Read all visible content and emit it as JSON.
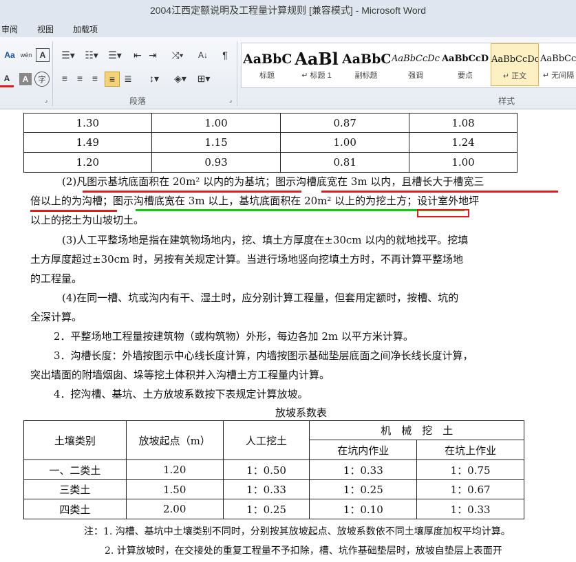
{
  "window": {
    "title": "2004江西定额说明及工程量计算规则 [兼容模式] - Microsoft Word"
  },
  "menu": [
    "审阅",
    "视图",
    "加载项"
  ],
  "ribbon": {
    "paragraph_group": "段落",
    "styles_group": "样式",
    "styles": [
      {
        "sample": "AaBbC",
        "name": "标题"
      },
      {
        "sample": "AaBl",
        "name": "↵ 标题 1"
      },
      {
        "sample": "AaBbC",
        "name": "副标题"
      },
      {
        "sample": "AaBbCcDc",
        "name": "强调"
      },
      {
        "sample": "AaBbCcD",
        "name": "要点"
      },
      {
        "sample": "AaBbCcDc",
        "name": "↵ 正文",
        "active": true
      },
      {
        "sample": "AaBbCcI",
        "name": "↵ 无间隔"
      }
    ]
  },
  "top_table": [
    [
      "1.30",
      "1.00",
      "0.87",
      "1.08"
    ],
    [
      "1.49",
      "1.15",
      "1.00",
      "1.24"
    ],
    [
      "1.20",
      "0.93",
      "0.81",
      "1.00"
    ]
  ],
  "p2": {
    "l1": "(2)凡图示基坑底面积在 20m² 以内的为基坑；图示沟槽底宽在 3m 以内，且槽长大于槽宽三",
    "l2": "倍以上的为沟槽；图示沟槽底宽在 3m 以上，基坑底面积在 20m² 以上的为挖土方；设计室外地坪",
    "l3": "以上的挖土为山坡切土。"
  },
  "p3": {
    "l1": "(3)人工平整场地是指在建筑物场地内，挖、填土方厚度在±30cm 以内的就地找平。挖填",
    "l2": "土方厚度超过±30cm 时，另按有关规定计算。当进行场地竖向挖填土方时，不再计算平整场地",
    "l3": "的工程量。"
  },
  "p4": {
    "l1": "(4)在同一槽、坑或沟内有干、湿土时，应分别计算工程量，但套用定额时，按槽、坑的",
    "l2": "全深计算。"
  },
  "item2": "2．平整场地工程量按建筑物（或构筑物）外形，每边各加 2m 以平方米计算。",
  "item3": {
    "l1": "3．沟槽长度：外墙按图示中心线长度计算，内墙按图示基础垫层底面之间净长线长度计算，",
    "l2": "突出墙面的附墙烟囱、垛等挖土体积并入沟槽土方工程量内计算。"
  },
  "item4": "4．挖沟槽、基坑、土方放坡系数按下表规定计算放坡。",
  "slope_table": {
    "caption": "放坡系数表",
    "headers": {
      "soil": "土壤类别",
      "start": "放坡起点（m）",
      "manual": "人工挖土",
      "machine": "机　械　挖　土",
      "in_pit": "在坑内作业",
      "on_pit": "在坑上作业"
    },
    "rows": [
      [
        "一、二类土",
        "1.20",
        "1：0.50",
        "1：0.33",
        "1：0.75"
      ],
      [
        "三类土",
        "1.50",
        "1：0.33",
        "1：0.25",
        "1：0.67"
      ],
      [
        "四类土",
        "2.00",
        "1：0.25",
        "1：0.10",
        "1：0.33"
      ]
    ]
  },
  "notes": {
    "n1": "注：1. 沟槽、基坑中土壤类别不同时，分别按其放坡起点、放坡系数依不同土壤厚度加权平均计算。",
    "n2": "2. 计算放坡时，在交接处的重复工程量不予扣除，槽、坑作基础垫层时，放坡自垫层上表面开"
  },
  "colors": {
    "red_mark": "#e21b1b",
    "green_mark": "#17c517",
    "ribbon_bg": "#dfe6ef"
  }
}
